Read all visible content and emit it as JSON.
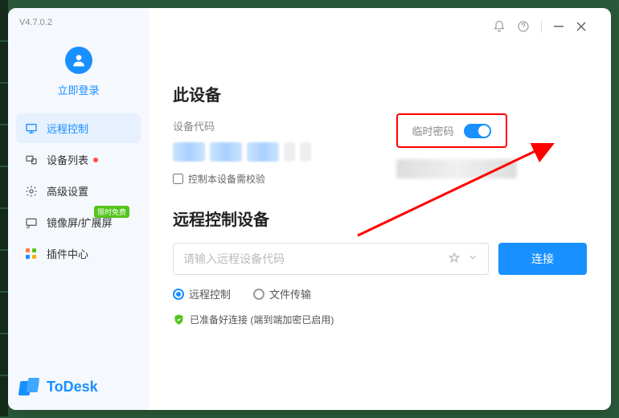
{
  "version": "V4.7.0.2",
  "login_link": "立即登录",
  "nav": {
    "remote_control": "远程控制",
    "device_list": "设备列表",
    "advanced_settings": "高级设置",
    "mirror_extend": "镜像屏/扩展屏",
    "mirror_badge": "限时免费",
    "plugin_center": "插件中心"
  },
  "brand": "ToDesk",
  "this_device": {
    "title": "此设备",
    "code_label": "设备代码",
    "checkbox_label": "控制本设备需校验"
  },
  "temp_password": {
    "label": "临时密码"
  },
  "remote": {
    "title": "远程控制设备",
    "placeholder": "请输入远程设备代码",
    "connect": "连接",
    "option_control": "远程控制",
    "option_file": "文件传输"
  },
  "status": "已准备好连接 (端到端加密已启用)"
}
